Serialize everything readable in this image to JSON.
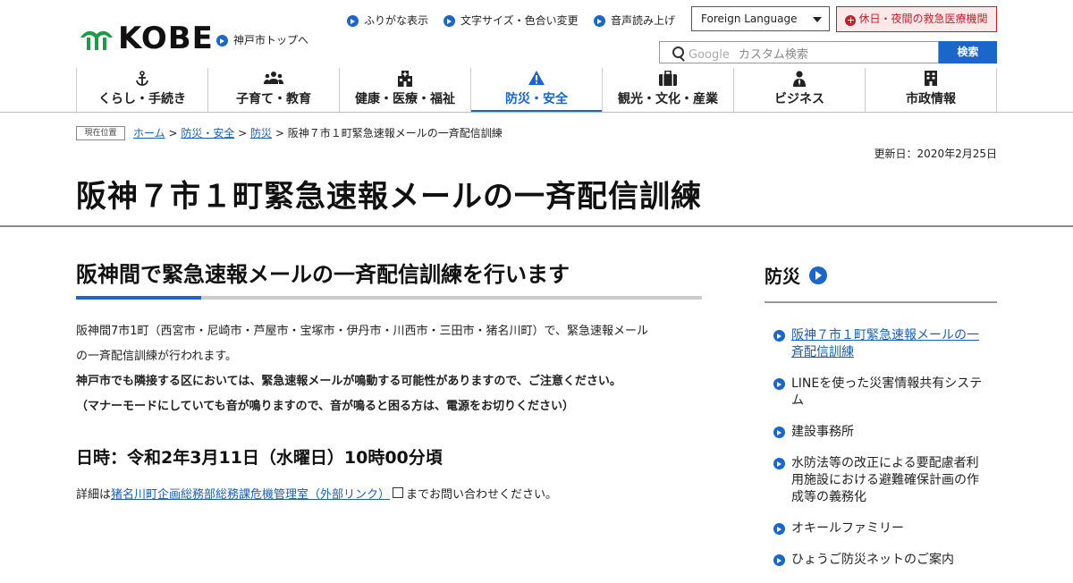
{
  "header": {
    "logo_text": "KOBE",
    "top_link": "神戸市トップへ",
    "utilities": [
      "ふりがな表示",
      "文字サイズ・色合い変更",
      "音声読み上げ"
    ],
    "language_select": "Foreign Language",
    "emergency": "休日・夜間の救急医療機関",
    "search_google": "Google",
    "search_placeholder": "カスタム検索",
    "search_button": "検索"
  },
  "nav": [
    {
      "label": "くらし・手続き",
      "icon": "anchor-icon"
    },
    {
      "label": "子育て・教育",
      "icon": "people-icon"
    },
    {
      "label": "健康・医療・福祉",
      "icon": "hospital-icon"
    },
    {
      "label": "防災・安全",
      "icon": "warning-icon",
      "active": true
    },
    {
      "label": "観光・文化・産業",
      "icon": "suitcase-icon"
    },
    {
      "label": "ビジネス",
      "icon": "businessperson-icon"
    },
    {
      "label": "市政情報",
      "icon": "building-icon"
    }
  ],
  "breadcrumb": {
    "tag": "現在位置",
    "items": [
      "ホーム",
      "防災・安全",
      "防災"
    ],
    "current": "阪神７市１町緊急速報メールの一斉配信訓練"
  },
  "updated": "更新日：2020年2月25日",
  "page_title": "阪神７市１町緊急速報メールの一斉配信訓練",
  "main": {
    "heading": "阪神間で緊急速報メールの一斉配信訓練を行います",
    "para1a": "阪神間7市1町（西宮市・尼崎市・芦屋市・宝塚市・伊丹市・川西市・三田市・猪名川町）で、緊急速報メール",
    "para1b": "の一斉配信訓練が行われます。",
    "para2": "神戸市でも隣接する区においては、緊急速報メールが鳴動する可能性がありますので、ご注意ください。",
    "para3": "（マナーモードにしていても音が鳴りますので、音が鳴ると困る方は、電源をお切りください）",
    "datetime": "日時：令和2年3月11日（水曜日）10時00分頃",
    "detail_prefix": "詳細は",
    "detail_link": "猪名川町企画総務部総務課危機管理室（外部リンク）",
    "detail_suffix": "までお問い合わせください。"
  },
  "sidebar": {
    "heading": "防災",
    "items": [
      "阪神７市１町緊急速報メールの一斉配信訓練",
      "LINEを使った災害情報共有システム",
      "建設事務所",
      "水防法等の改正による要配慮者利用施設における避難確保計画の作成等の義務化",
      "オキールファミリー",
      "ひょうご防災ネットのご案内"
    ]
  }
}
